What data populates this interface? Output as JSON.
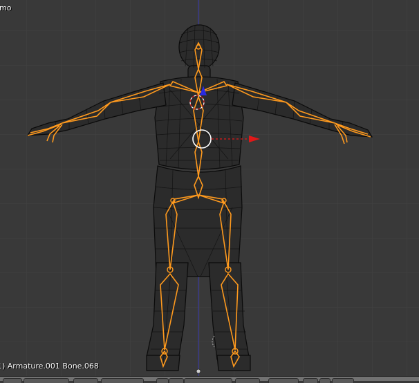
{
  "viewport": {
    "view_name": "mo",
    "object_info": "1) Armature.001 Bone.068"
  },
  "colors": {
    "background": "#393939",
    "grid_line": "#444444",
    "wire": "#0b0b0b",
    "bone_selected": "#ff9a1e",
    "y_axis_line": "#3b3bd0",
    "manipulator_x": "#e01818",
    "manipulator_z": "#2a2ae0"
  },
  "header": {
    "buttons": [
      "view-menu",
      "select-menu",
      "pose-menu",
      "mode-selector",
      "shading-selector",
      "pivot-selector",
      "manipulator-toggle",
      "layers",
      "snap"
    ]
  }
}
